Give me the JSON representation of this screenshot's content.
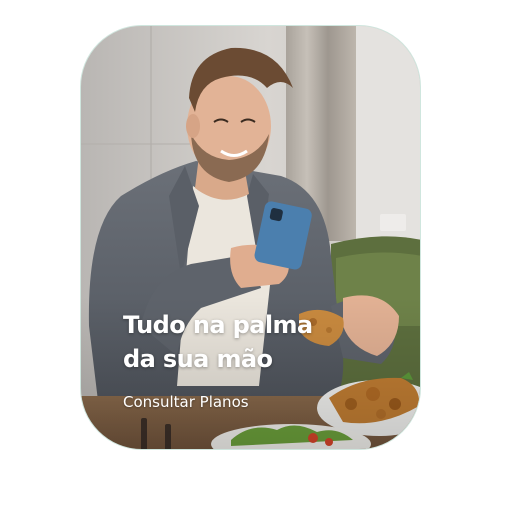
{
  "banner": {
    "headline_line1": "Tudo na palma",
    "headline_line2": "da sua mão",
    "cta_label": "Consultar Planos"
  },
  "colors": {
    "border": "#cfe6de",
    "text": "#ffffff"
  }
}
